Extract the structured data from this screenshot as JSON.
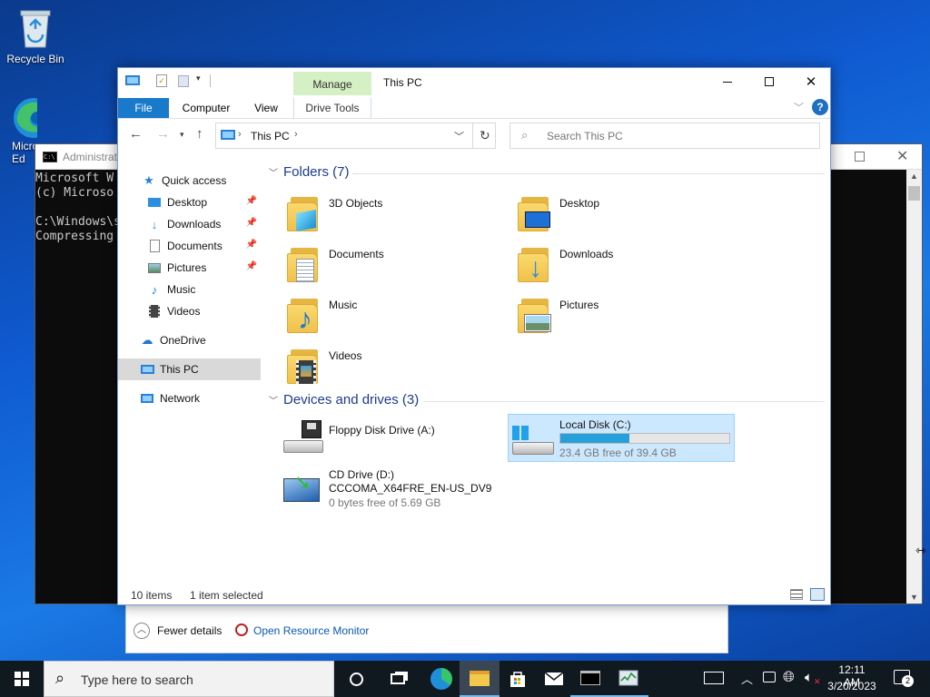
{
  "desktop": {
    "icons": [
      {
        "label": "Recycle Bin"
      },
      {
        "label": "Micro Ed"
      }
    ]
  },
  "cmd": {
    "title": "Administrat",
    "lines": [
      "Microsoft W",
      "(c) Microso",
      "",
      "C:\\Windows\\s",
      "Compressing"
    ]
  },
  "taskmgr": {
    "fewer_details": "Fewer details",
    "open_resource_monitor": "Open Resource Monitor"
  },
  "explorer": {
    "title": "This PC",
    "manage_tab": "Manage",
    "drive_tools_tab": "Drive Tools",
    "tabs": {
      "file": "File",
      "computer": "Computer",
      "view": "View"
    },
    "address_path": "This PC",
    "search_placeholder": "Search This PC",
    "sidebar": {
      "quick_access": "Quick access",
      "desktop": "Desktop",
      "downloads": "Downloads",
      "documents": "Documents",
      "pictures": "Pictures",
      "music": "Music",
      "videos": "Videos",
      "onedrive": "OneDrive",
      "this_pc": "This PC",
      "network": "Network"
    },
    "folders_header": "Folders (7)",
    "folders": {
      "objects3d": "3D Objects",
      "desktop": "Desktop",
      "documents": "Documents",
      "downloads": "Downloads",
      "music": "Music",
      "pictures": "Pictures",
      "videos": "Videos"
    },
    "devices_header": "Devices and drives (3)",
    "drives": {
      "floppy": {
        "name": "Floppy Disk Drive (A:)"
      },
      "local": {
        "name": "Local Disk (C:)",
        "free": "23.4 GB free of 39.4 GB",
        "used_fraction": 0.406
      },
      "cd": {
        "name": "CD Drive (D:)",
        "label": "CCCOMA_X64FRE_EN-US_DV9",
        "free": "0 bytes free of 5.69 GB"
      }
    },
    "status": {
      "items": "10 items",
      "selected": "1 item selected"
    }
  },
  "taskbar": {
    "search_placeholder": "Type here to search",
    "time": "12:11 AM",
    "date": "3/20/2023",
    "notification_count": "2"
  },
  "colors": {
    "accent": "#0063b1",
    "selection": "#cce8ff",
    "manage_tab": "#d5f0c4",
    "progress": "#26a0da"
  }
}
